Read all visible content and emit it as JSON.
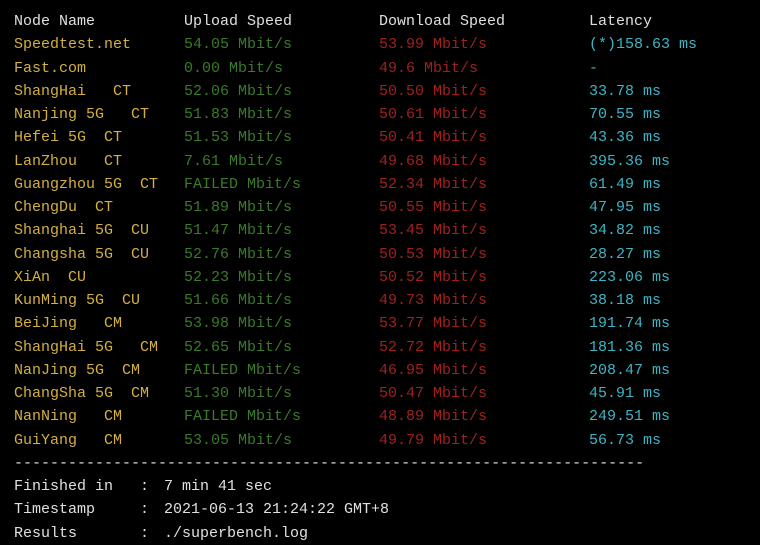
{
  "headers": {
    "node": "Node Name",
    "upload": "Upload Speed",
    "download": "Download Speed",
    "latency": "Latency"
  },
  "rows": [
    {
      "node": "Speedtest.net",
      "upload": "54.05 Mbit/s",
      "download": "53.99 Mbit/s",
      "latency": "(*)158.63 ms"
    },
    {
      "node": "Fast.com",
      "upload": "0.00 Mbit/s",
      "download": "49.6 Mbit/s",
      "latency": "-"
    },
    {
      "node": "ShangHai   CT",
      "upload": "52.06 Mbit/s",
      "download": "50.50 Mbit/s",
      "latency": "33.78 ms"
    },
    {
      "node": "Nanjing 5G   CT",
      "upload": "51.83 Mbit/s",
      "download": "50.61 Mbit/s",
      "latency": "70.55 ms"
    },
    {
      "node": "Hefei 5G  CT",
      "upload": "51.53 Mbit/s",
      "download": "50.41 Mbit/s",
      "latency": "43.36 ms"
    },
    {
      "node": "LanZhou   CT",
      "upload": "7.61 Mbit/s",
      "download": "49.68 Mbit/s",
      "latency": "395.36 ms"
    },
    {
      "node": "Guangzhou 5G  CT",
      "upload": "FAILED Mbit/s",
      "download": "52.34 Mbit/s",
      "latency": "61.49 ms"
    },
    {
      "node": "ChengDu  CT",
      "upload": "51.89 Mbit/s",
      "download": "50.55 Mbit/s",
      "latency": "47.95 ms"
    },
    {
      "node": "Shanghai 5G  CU",
      "upload": "51.47 Mbit/s",
      "download": "53.45 Mbit/s",
      "latency": "34.82 ms"
    },
    {
      "node": "Changsha 5G  CU",
      "upload": "52.76 Mbit/s",
      "download": "50.53 Mbit/s",
      "latency": "28.27 ms"
    },
    {
      "node": "XiAn  CU",
      "upload": "52.23 Mbit/s",
      "download": "50.52 Mbit/s",
      "latency": "223.06 ms"
    },
    {
      "node": "KunMing 5G  CU",
      "upload": "51.66 Mbit/s",
      "download": "49.73 Mbit/s",
      "latency": "38.18 ms"
    },
    {
      "node": "BeiJing   CM",
      "upload": "53.98 Mbit/s",
      "download": "53.77 Mbit/s",
      "latency": "191.74 ms"
    },
    {
      "node": "ShangHai 5G   CM",
      "upload": "52.65 Mbit/s",
      "download": "52.72 Mbit/s",
      "latency": "181.36 ms"
    },
    {
      "node": "NanJing 5G  CM",
      "upload": "FAILED Mbit/s",
      "download": "46.95 Mbit/s",
      "latency": "208.47 ms"
    },
    {
      "node": "ChangSha 5G  CM",
      "upload": "51.30 Mbit/s",
      "download": "50.47 Mbit/s",
      "latency": "45.91 ms"
    },
    {
      "node": "NanNing   CM",
      "upload": "FAILED Mbit/s",
      "download": "48.89 Mbit/s",
      "latency": "249.51 ms"
    },
    {
      "node": "GuiYang   CM",
      "upload": "53.05 Mbit/s",
      "download": "49.79 Mbit/s",
      "latency": "56.73 ms"
    }
  ],
  "separator": "----------------------------------------------------------------------",
  "footer": {
    "finished_label": "Finished in   :",
    "finished_value": "7 min 41 sec",
    "timestamp_label": "Timestamp     :",
    "timestamp_value": "2021-06-13 21:24:22 GMT+8",
    "results_label": "Results       :",
    "results_value": "./superbench.log"
  }
}
